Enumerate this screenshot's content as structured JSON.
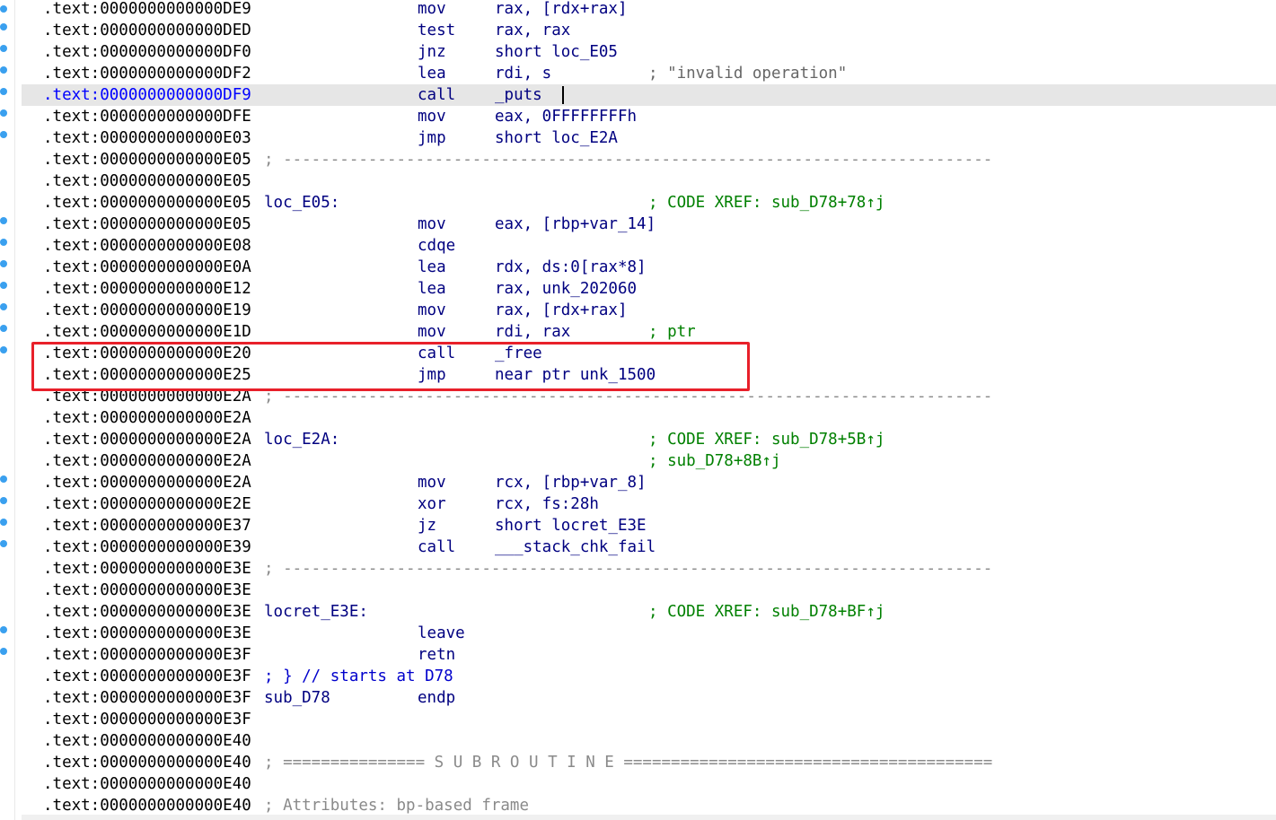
{
  "listing": [
    {
      "addr": ".text:0000000000000DE9",
      "mnemonic": "mov",
      "operands": "rax, [rdx+rax]"
    },
    {
      "addr": ".text:0000000000000DED",
      "mnemonic": "test",
      "operands": "rax, rax"
    },
    {
      "addr": ".text:0000000000000DF0",
      "mnemonic": "jnz",
      "operands": "short loc_E05"
    },
    {
      "addr": ".text:0000000000000DF2",
      "mnemonic": "lea",
      "operands": "rdi, s",
      "comment": "; \"invalid operation\"",
      "comment_style": "string"
    },
    {
      "addr": ".text:0000000000000DF9",
      "mnemonic": "call",
      "operands": "_puts",
      "current": true
    },
    {
      "addr": ".text:0000000000000DFE",
      "mnemonic": "mov",
      "operands": "eax, 0FFFFFFFFh"
    },
    {
      "addr": ".text:0000000000000E03",
      "mnemonic": "jmp",
      "operands": "short loc_E2A"
    },
    {
      "addr": ".text:0000000000000E05",
      "separator": "; ---------------------------------------------------------------------------"
    },
    {
      "addr": ".text:0000000000000E05"
    },
    {
      "addr": ".text:0000000000000E05",
      "label": "loc_E05:",
      "comment": "; CODE XREF: sub_D78+78↑j"
    },
    {
      "addr": ".text:0000000000000E05",
      "mnemonic": "mov",
      "operands": "eax, [rbp+var_14]"
    },
    {
      "addr": ".text:0000000000000E08",
      "mnemonic": "cdqe"
    },
    {
      "addr": ".text:0000000000000E0A",
      "mnemonic": "lea",
      "operands": "rdx, ds:0[rax*8]"
    },
    {
      "addr": ".text:0000000000000E12",
      "mnemonic": "lea",
      "operands": "rax, unk_202060"
    },
    {
      "addr": ".text:0000000000000E19",
      "mnemonic": "mov",
      "operands": "rax, [rdx+rax]"
    },
    {
      "addr": ".text:0000000000000E1D",
      "mnemonic": "mov",
      "operands": "rdi, rax",
      "comment": "; ptr"
    },
    {
      "addr": ".text:0000000000000E20",
      "mnemonic": "call",
      "operands": "_free"
    },
    {
      "addr": ".text:0000000000000E25",
      "mnemonic": "jmp",
      "operands": "near ptr unk_1500"
    },
    {
      "addr": ".text:0000000000000E2A",
      "separator": "; ---------------------------------------------------------------------------"
    },
    {
      "addr": ".text:0000000000000E2A"
    },
    {
      "addr": ".text:0000000000000E2A",
      "label": "loc_E2A:",
      "comment": "; CODE XREF: sub_D78+5B↑j"
    },
    {
      "addr": ".text:0000000000000E2A",
      "comment": "; sub_D78+8B↑j"
    },
    {
      "addr": ".text:0000000000000E2A",
      "mnemonic": "mov",
      "operands": "rcx, [rbp+var_8]"
    },
    {
      "addr": ".text:0000000000000E2E",
      "mnemonic": "xor",
      "operands": "rcx, fs:28h"
    },
    {
      "addr": ".text:0000000000000E37",
      "mnemonic": "jz",
      "operands": "short locret_E3E"
    },
    {
      "addr": ".text:0000000000000E39",
      "mnemonic": "call",
      "operands": "___stack_chk_fail"
    },
    {
      "addr": ".text:0000000000000E3E",
      "separator": "; ---------------------------------------------------------------------------"
    },
    {
      "addr": ".text:0000000000000E3E"
    },
    {
      "addr": ".text:0000000000000E3E",
      "label": "locret_E3E:",
      "comment": "; CODE XREF: sub_D78+BF↑j"
    },
    {
      "addr": ".text:0000000000000E3E",
      "mnemonic": "leave"
    },
    {
      "addr": ".text:0000000000000E3F",
      "mnemonic": "retn"
    },
    {
      "addr": ".text:0000000000000E3F",
      "label": "; } // starts at D78"
    },
    {
      "addr": ".text:0000000000000E3F",
      "label": "sub_D78",
      "mnemonic": "endp"
    },
    {
      "addr": ".text:0000000000000E3F"
    },
    {
      "addr": ".text:0000000000000E40"
    },
    {
      "addr": ".text:0000000000000E40",
      "separator": "; =============== S U B R O U T I N E ======================================="
    },
    {
      "addr": ".text:0000000000000E40"
    },
    {
      "addr": ".text:0000000000000E40",
      "separator": "; Attributes: bp-based frame"
    }
  ],
  "highlight": {
    "color": "#e8202a"
  },
  "colors": {
    "address": "#000000",
    "current_address": "#0000ff",
    "instruction": "#000080",
    "comment": "#008000",
    "separator": "#8a8a8a",
    "current_line_bg": "#e6e6e6",
    "gutter_dot": "#3aa0ef"
  }
}
